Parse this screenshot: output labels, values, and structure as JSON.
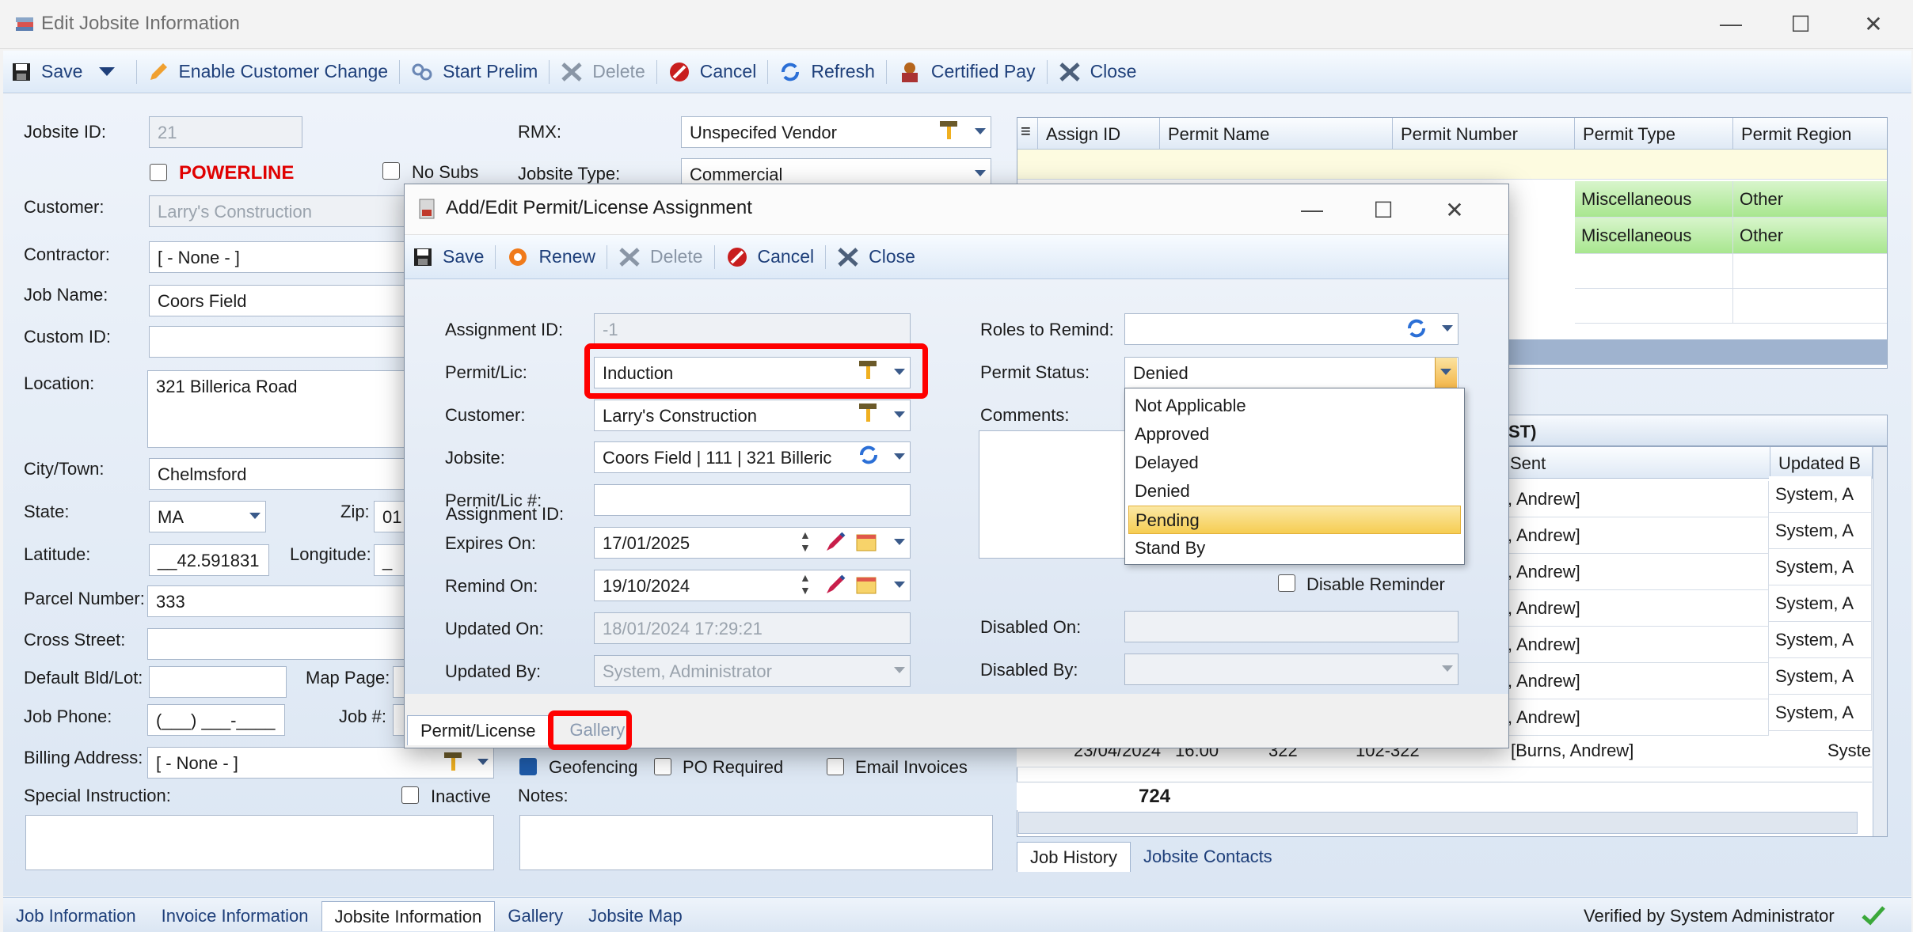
{
  "window": {
    "title": "Edit Jobsite Information"
  },
  "toolbar": {
    "save": "Save",
    "enable_customer_change": "Enable Customer Change",
    "start_prelim": "Start Prelim",
    "delete": "Delete",
    "cancel": "Cancel",
    "refresh": "Refresh",
    "certified_pay": "Certified Pay",
    "close": "Close"
  },
  "form": {
    "jobsite_id_label": "Jobsite ID:",
    "jobsite_id": "21",
    "powerline_label": "POWERLINE",
    "no_subs_label": "No Subs",
    "customer_label": "Customer:",
    "customer": "Larry's Construction",
    "contractor_label": "Contractor:",
    "contractor": "[ - None - ]",
    "job_name_label": "Job Name:",
    "job_name": "Coors Field",
    "custom_id_label": "Custom ID:",
    "custom_id": "",
    "location_label": "Location:",
    "location": "321 Billerica Road",
    "city_label": "City/Town:",
    "city": "Chelmsford",
    "state_label": "State:",
    "state": "MA",
    "zip_label": "Zip:",
    "zip": "01",
    "latitude_label": "Latitude:",
    "latitude": "__42.591831",
    "longitude_label": "Longitude:",
    "longitude": "_",
    "parcel_label": "Parcel Number:",
    "parcel": "333",
    "cross_street_label": "Cross Street:",
    "default_bld_label": "Default Bld/Lot:",
    "map_page_label": "Map Page:",
    "job_phone_label": "Job Phone:",
    "job_phone": "(___) ___-____",
    "job_num_label": "Job #:",
    "billing_label": "Billing Address:",
    "billing": "[ - None - ]",
    "special_label": "Special Instruction:",
    "inactive_label": "Inactive",
    "rmx_label": "RMX:",
    "rmx": "Unspecifed Vendor",
    "jobsite_type_label": "Jobsite Type:",
    "jobsite_type": "Commercial",
    "geofencing_label": "Geofencing",
    "po_required_label": "PO Required",
    "email_invoices_label": "Email Invoices",
    "notes_label": "Notes:"
  },
  "permit_grid": {
    "headers": [
      "Assign ID",
      "Permit Name",
      "Permit Number",
      "Permit Type",
      "Permit Region"
    ],
    "rows": [
      {
        "type": "Miscellaneous",
        "region": "Other"
      },
      {
        "type": "Miscellaneous",
        "region": "Other"
      }
    ]
  },
  "history_grid": {
    "section_title": "ST)",
    "headers": [
      "Sent",
      "Updated B"
    ],
    "rows": [
      {
        "sent": ", Andrew]",
        "updated": "System, A"
      },
      {
        "sent": ", Andrew]",
        "updated": "System, A"
      },
      {
        "sent": ", Andrew]",
        "updated": "System, A"
      },
      {
        "sent": ", Andrew]",
        "updated": "System, A"
      },
      {
        "sent": ", Andrew]",
        "updated": "System, A"
      },
      {
        "sent": ", Andrew]",
        "updated": "System, A"
      },
      {
        "sent": ", Andrew]",
        "updated": "System, A"
      }
    ],
    "last_row": {
      "date": "23/04/2024",
      "time": "16:00",
      "num": "322",
      "code": "102-322",
      "sent": "[Burns, Andrew]",
      "updated": "System, A"
    },
    "total": "724"
  },
  "right_tabs": [
    "Job History",
    "Jobsite Contacts"
  ],
  "bottom_tabs": [
    "Job Information",
    "Invoice Information",
    "Jobsite Information",
    "Gallery",
    "Jobsite Map"
  ],
  "status": {
    "verified": "Verified by System Administrator"
  },
  "dialog": {
    "title": "Add/Edit Permit/License Assignment",
    "toolbar": {
      "save": "Save",
      "renew": "Renew",
      "delete": "Delete",
      "cancel": "Cancel",
      "close": "Close"
    },
    "assignment_id_label": "Assignment ID:",
    "assignment_id": "-1",
    "permit_lic_label": "Permit/Lic:",
    "permit_lic": "Induction",
    "customer_label": "Customer:",
    "customer": "Larry's Construction",
    "jobsite_label": "Jobsite:",
    "jobsite": "Coors Field | 111 | 321 Billeric",
    "permit_num_label": "Permit/Lic #:",
    "permit_num": "",
    "expires_label": "Expires On:",
    "expires": "17/01/2025",
    "remind_label": "Remind On:",
    "remind": "19/10/2024",
    "updated_on_label": "Updated On:",
    "updated_on": "18/01/2024 17:29:21",
    "updated_by_label": "Updated By:",
    "updated_by": "System, Administrator",
    "roles_label": "Roles to Remind:",
    "status_label": "Permit Status:",
    "status": "Denied",
    "comments_label": "Comments:",
    "disable_reminder_label": "Disable Reminder",
    "disabled_on_label": "Disabled On:",
    "disabled_by_label": "Disabled By:",
    "tabs": [
      "Permit/License",
      "Gallery"
    ],
    "status_options": [
      "Not Applicable",
      "Approved",
      "Delayed",
      "Denied",
      "Pending",
      "Stand By"
    ],
    "status_highlighted": "Pending"
  }
}
